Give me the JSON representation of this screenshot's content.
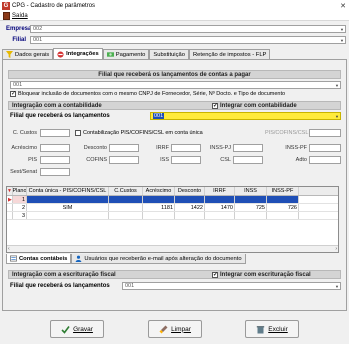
{
  "window": {
    "title": "CPG - Cadastro de parâmetros"
  },
  "menu": {
    "exit_label": "Saída"
  },
  "header": {
    "empresa_label": "Empresa",
    "empresa_value": "002",
    "filial_label": "Filial",
    "filial_value": "001"
  },
  "tabs": [
    {
      "label": "Dados gerais",
      "icon": "funnel-icon"
    },
    {
      "label": "Integrações",
      "icon": "no-entry-icon"
    },
    {
      "label": "Pagamento",
      "icon": "money-icon"
    },
    {
      "label": "Substituição",
      "icon": ""
    },
    {
      "label": "Retenção de impostos - FLP",
      "icon": ""
    }
  ],
  "payables": {
    "title": "Filial que receberá os lançamentos de contas a pagar",
    "select_value": "001",
    "block_checkbox_label": "Bloquear inclusão de documentos com o mesmo CNPJ de Fornecedor, Série, Nº Docto. e Tipo de documento"
  },
  "accounting": {
    "title": "Integração com a contabilidade",
    "integrate_label": "Integrar com contabilidade",
    "filial_label": "Filial que receberá os lançamentos",
    "filial_value": "001",
    "c_custos_label": "C. Custos",
    "pis_single_label": "Contabilização PIS/COFINS/CSL em conta única",
    "pis_cofins_csl_label": "PIS/COFINS/CSL",
    "acrescimo_label": "Acréscimo",
    "desconto_label": "Desconto",
    "irrf_label": "IRRF",
    "inss_pj_label": "INSS-PJ",
    "inss_pf_label": "INSS-PF",
    "pis_label": "PIS",
    "cofins_label": "COFINS",
    "iss_label": "ISS",
    "csl_label": "CSL",
    "adto_label": "Adto",
    "sest_senat_label": "Sest/Senat"
  },
  "grid": {
    "headers": [
      "",
      "Plano",
      "Conta única - PIS/COFINS/CSL",
      "C.Custos",
      "Acréscimo",
      "Desconto",
      "IRRF",
      "INSS",
      "INSS-PF"
    ],
    "rows": [
      {
        "plano": "1",
        "conta_unica": "",
        "ccustos": "",
        "acrescimo": "",
        "desconto": "",
        "irrf": "",
        "inss": "",
        "inss_pf": ""
      },
      {
        "plano": "2",
        "conta_unica": "SIM",
        "ccustos": "",
        "acrescimo": "1181",
        "desconto": "1422",
        "irrf": "1470",
        "inss": "725",
        "inss_pf": "726"
      },
      {
        "plano": "3",
        "conta_unica": "",
        "ccustos": "",
        "acrescimo": "",
        "desconto": "",
        "irrf": "",
        "inss": "",
        "inss_pf": ""
      }
    ]
  },
  "bottom_tabs": [
    {
      "label": "Contas contábeis"
    },
    {
      "label": "Usuários que receberão e-mail após alteração do documento"
    }
  ],
  "fiscal": {
    "title": "Integração com a escrituração fiscal",
    "integrate_label": "Integrar com escrituração fiscal",
    "filial_label": "Filial que receberá os lançamentos",
    "filial_value": "001"
  },
  "buttons": {
    "save_label": "Gravar",
    "clear_label": "Limpar",
    "delete_label": "Excluir"
  },
  "colors": {
    "accent": "#00007a",
    "selection": "#1f4fb6",
    "highlight": "#ffeb3b"
  }
}
